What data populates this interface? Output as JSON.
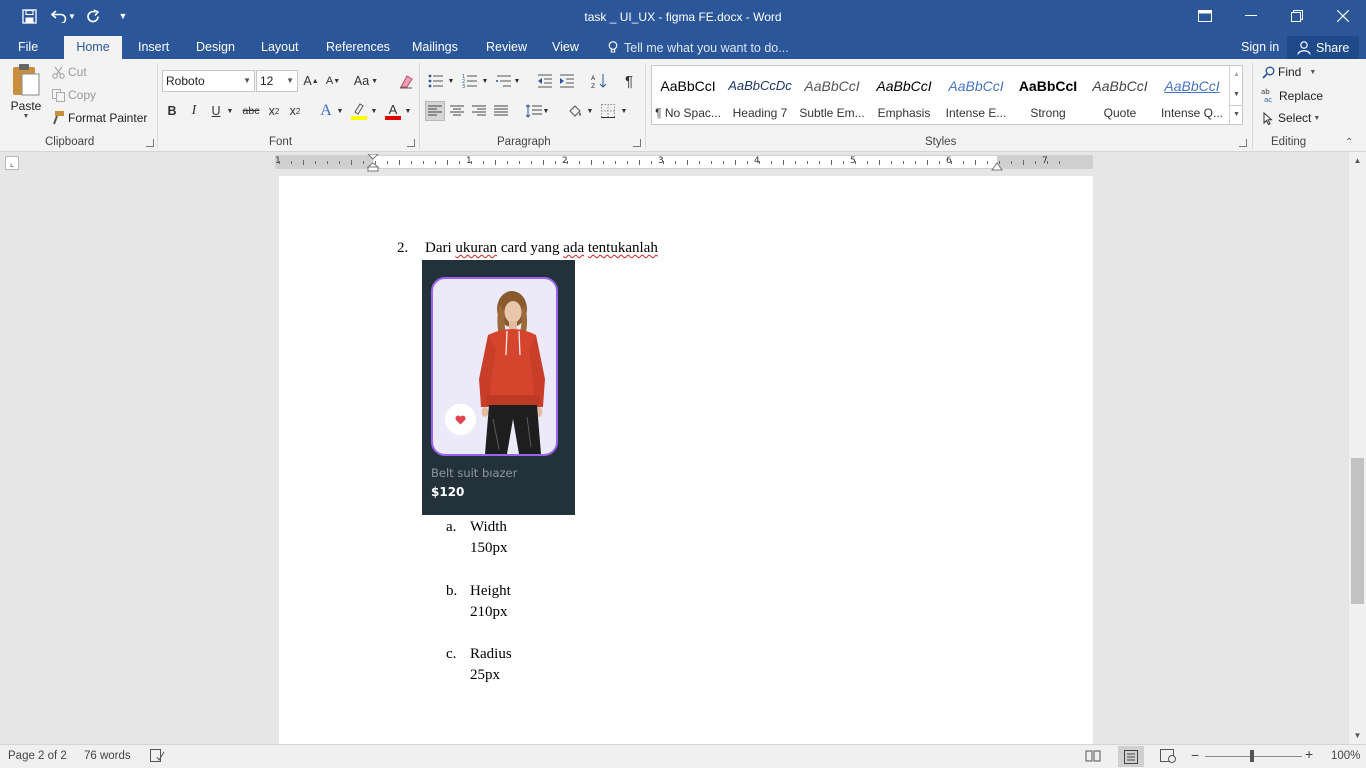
{
  "window": {
    "title": "task _ UI_UX - figma FE.docx - Word"
  },
  "tabs": {
    "file": "File",
    "home": "Home",
    "insert": "Insert",
    "design": "Design",
    "layout": "Layout",
    "references": "References",
    "mailings": "Mailings",
    "review": "Review",
    "view": "View",
    "tell_me": "Tell me what you want to do...",
    "sign_in": "Sign in",
    "share": "Share"
  },
  "clipboard": {
    "paste": "Paste",
    "cut": "Cut",
    "copy": "Copy",
    "format_painter": "Format Painter",
    "group": "Clipboard"
  },
  "font": {
    "name": "Roboto",
    "size": "12",
    "group": "Font",
    "change_case": "Aa"
  },
  "paragraph": {
    "group": "Paragraph"
  },
  "styles": {
    "group": "Styles",
    "items": [
      {
        "preview": "AaBbCcI",
        "name": "¶ No Spac..."
      },
      {
        "preview": "AaBbCcDc",
        "name": "Heading 7"
      },
      {
        "preview": "AaBbCcI",
        "name": "Subtle Em..."
      },
      {
        "preview": "AaBbCcI",
        "name": "Emphasis"
      },
      {
        "preview": "AaBbCcI",
        "name": "Intense E..."
      },
      {
        "preview": "AaBbCcI",
        "name": "Strong"
      },
      {
        "preview": "AaBbCcI",
        "name": "Quote"
      },
      {
        "preview": "AaBbCcI",
        "name": "Intense Q..."
      }
    ]
  },
  "editing": {
    "find": "Find",
    "replace": "Replace",
    "select": "Select",
    "group": "Editing"
  },
  "ruler": {
    "numbers": [
      "1",
      "1",
      "2",
      "3",
      "4",
      "5",
      "6",
      "7"
    ]
  },
  "document": {
    "item_number": "2.",
    "item_text_1": "Dari ",
    "item_text_2": "ukuran",
    "item_text_3": " card yang ",
    "item_text_4": "ada",
    "item_text_5": " ",
    "item_text_6": "tentukanlah",
    "card": {
      "product_name": "Belt suit bıazer",
      "price": "$120"
    },
    "sub_items": [
      {
        "letter": "a.",
        "label": "Width",
        "value": "150px"
      },
      {
        "letter": "b.",
        "label": "Height",
        "value": "210px"
      },
      {
        "letter": "c.",
        "label": "Radius",
        "value": "25px"
      }
    ]
  },
  "status": {
    "page": "Page 2 of 2",
    "words": "76 words",
    "zoom": "100%"
  },
  "colors": {
    "word_blue": "#2b579a",
    "card_bg": "#23323a",
    "card_border": "#9b62f0",
    "sweater": "#d5452d"
  }
}
